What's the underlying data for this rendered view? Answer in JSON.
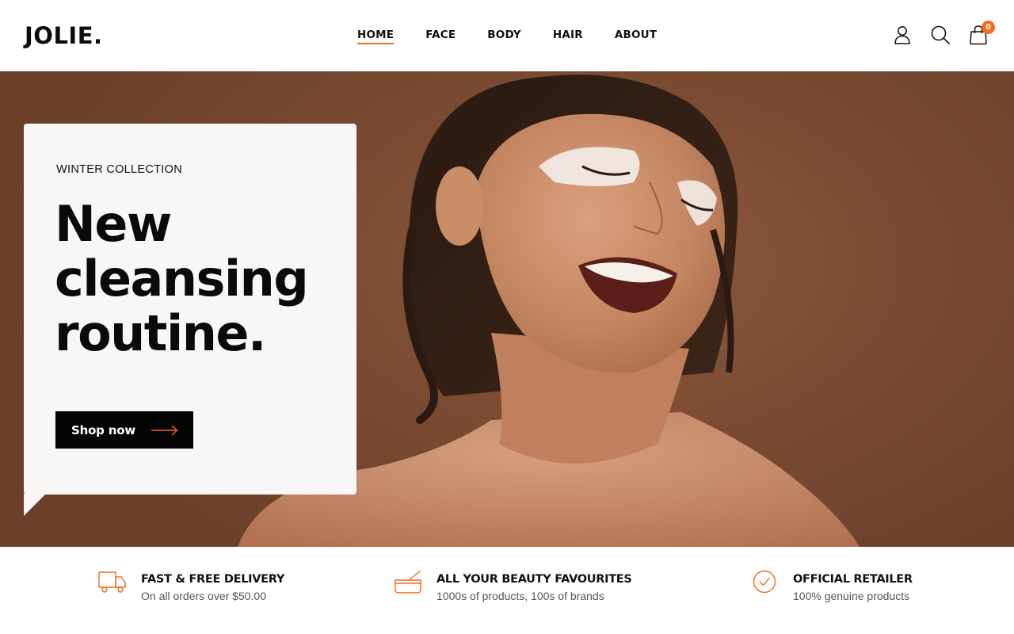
{
  "header": {
    "logo": "JOLIE.",
    "nav": [
      {
        "label": "HOME",
        "active": true
      },
      {
        "label": "FACE",
        "active": false
      },
      {
        "label": "BODY",
        "active": false
      },
      {
        "label": "HAIR",
        "active": false
      },
      {
        "label": "ABOUT",
        "active": false
      }
    ],
    "icons": [
      "user-icon",
      "search-icon",
      "shopping-bag-icon"
    ],
    "cart_count": "0"
  },
  "hero": {
    "eyebrow": "WINTER COLLECTION",
    "headline": [
      "New",
      "cleansing",
      "routine."
    ],
    "cta_label": "Shop now",
    "cta_icon": "arrow-right-icon"
  },
  "features": [
    {
      "icon": "delivery-truck-icon",
      "title": "FAST & FREE DELIVERY",
      "subtitle": "On all orders over $50.00"
    },
    {
      "icon": "cosmetics-jar-icon",
      "title": "ALL YOUR BEAUTY FAVOURITES",
      "subtitle": "1000s of products, 100s of brands"
    },
    {
      "icon": "check-circle-icon",
      "title": "OFFICIAL RETAILER",
      "subtitle": "100% genuine products"
    }
  ],
  "colors": {
    "accent": "#f26a1b",
    "hero_background": "#7b4c33",
    "card_background": "#f8f7f5",
    "button_background": "#050505"
  }
}
